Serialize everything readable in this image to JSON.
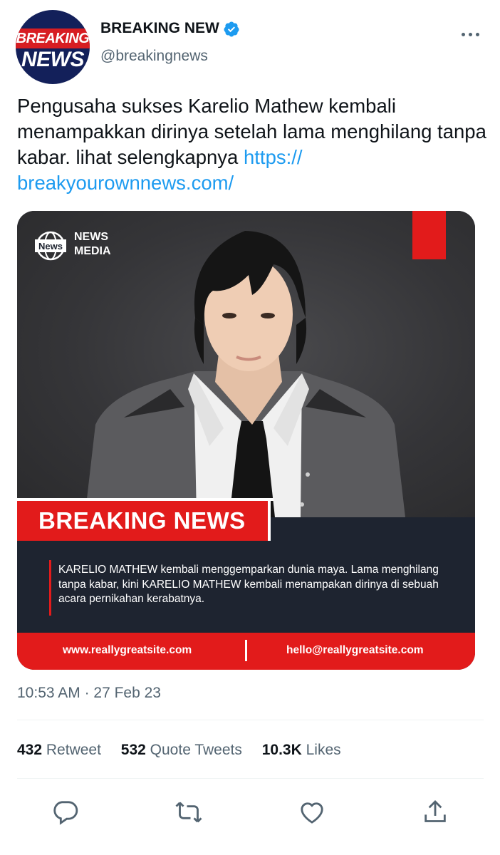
{
  "account": {
    "name": "BREAKING NEW",
    "handle": "@breakingnews",
    "avatar_line1": "BREAKING",
    "avatar_line2": "NEWS"
  },
  "tweet": {
    "text": "Pengusaha sukses Karelio Mathew kembali menampakkan dirinya setelah lama menghilang tanpa kabar. lihat selengkapnya ",
    "link": "https://\nbreakyourownnews.com/"
  },
  "media": {
    "logo_line1": "NEWS",
    "logo_line2": "MEDIA",
    "logo_badge": "News",
    "headline": "BREAKING NEWS",
    "description": "KARELIO MATHEW kembali menggemparkan dunia maya. Lama menghilang tanpa kabar, kini KARELIO MATHEW kembali menampakan dirinya di sebuah acara pernikahan kerabatnya.",
    "website": "www.reallygreatsite.com",
    "email": "hello@reallygreatsite.com"
  },
  "meta": {
    "time": "10:53 AM",
    "separator": " · ",
    "date": "27 Feb 23"
  },
  "stats": {
    "retweets": "432",
    "retweets_label": "Retweet",
    "quotes": "532",
    "quotes_label": "Quote Tweets",
    "likes": "10.3K",
    "likes_label": "Likes"
  },
  "colors": {
    "accent": "#1d9bf0",
    "news_red": "#e21b1b",
    "card_dark": "#1e2430"
  },
  "icons": [
    "verified-badge-icon",
    "more-options-icon",
    "reply-icon",
    "retweet-icon",
    "like-icon",
    "share-icon"
  ]
}
